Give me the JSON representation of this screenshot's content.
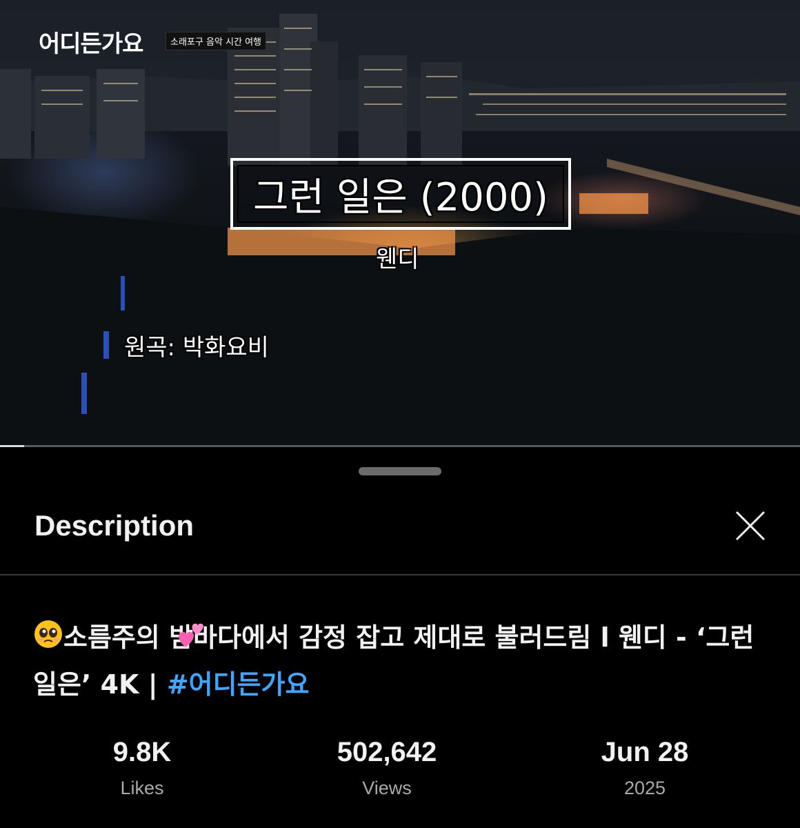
{
  "video": {
    "channel_logo": "어디든가요",
    "channel_subtitle": "소래포구 음악 시간 여행",
    "song_title": "그런 일은 (2000)",
    "song_artist": "웬디",
    "original_credit": "원곡: 박화요비",
    "progress_fraction": 0.03
  },
  "description_panel": {
    "title": "Description",
    "close_icon": "close-icon"
  },
  "video_info": {
    "title_text": "소름주의 밤바다에서 감정 잡고 제대로 불러드림 l 웬디 - ‘그런일은’ 4K | ",
    "hashtag": "#어디든가요",
    "emoji_1": "pleading-face-emoji",
    "emoji_2": "two-hearts-emoji"
  },
  "stats": {
    "likes": {
      "value": "9.8K",
      "label": "Likes"
    },
    "views": {
      "value": "502,642",
      "label": "Views"
    },
    "date": {
      "value": "Jun 28",
      "label": "2025"
    }
  },
  "colors": {
    "background": "#000000",
    "hashtag": "#3ea6ff",
    "secondary_text": "#aaaaaa",
    "progress_fill": "#dcdcdc"
  }
}
